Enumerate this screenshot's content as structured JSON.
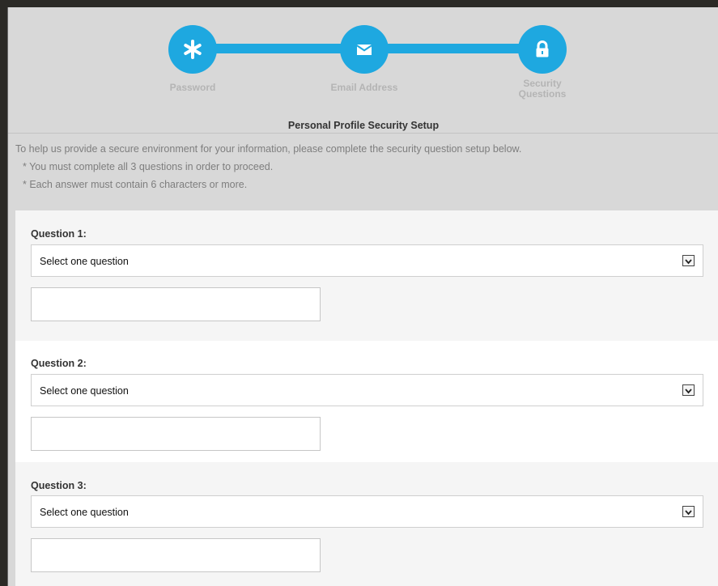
{
  "stepper": {
    "steps": [
      {
        "label_line1": "Password",
        "label_line2": "",
        "icon": "asterisk-icon"
      },
      {
        "label_line1": "Email Address",
        "label_line2": "",
        "icon": "envelope-icon"
      },
      {
        "label_line1": "Security",
        "label_line2": "Questions",
        "icon": "lock-icon"
      }
    ],
    "accent_color": "#1ea8e0"
  },
  "header": {
    "title": "Personal Profile Security Setup",
    "intro": "To help us provide a secure environment for your information, please complete the security question setup below.",
    "bullets": [
      "* You must complete all 3 questions in order to proceed.",
      "* Each answer must contain 6 characters or more."
    ]
  },
  "questions": [
    {
      "label": "Question 1:",
      "select_value": "Select one question",
      "answer_value": ""
    },
    {
      "label": "Question 2:",
      "select_value": "Select one question",
      "answer_value": ""
    },
    {
      "label": "Question 3:",
      "select_value": "Select one question",
      "answer_value": ""
    }
  ]
}
